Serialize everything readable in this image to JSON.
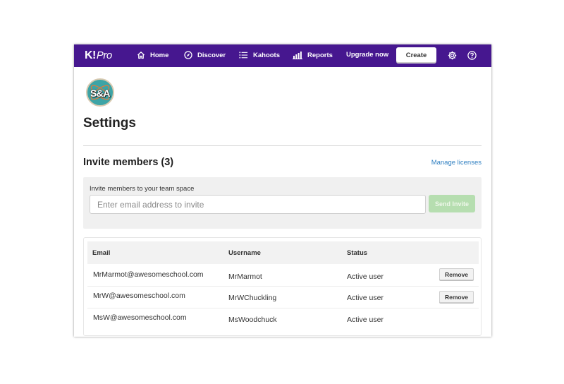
{
  "colors": {
    "nav_bg": "#46178f",
    "link": "#2f7fc1",
    "send_button_bg": "#b6deb0",
    "avatar_bg": "#3da4a6"
  },
  "nav": {
    "logo_main": "K!",
    "logo_pro": "Pro",
    "items": [
      {
        "label": "Home",
        "icon": "home-icon"
      },
      {
        "label": "Discover",
        "icon": "compass-icon"
      },
      {
        "label": "Kahoots",
        "icon": "list-icon"
      },
      {
        "label": "Reports",
        "icon": "bar-chart-icon"
      }
    ],
    "upgrade_label": "Upgrade now",
    "create_label": "Create",
    "settings_icon": "gear-icon",
    "help_icon": "help-icon"
  },
  "avatar": {
    "text": "S&A"
  },
  "page": {
    "title": "Settings"
  },
  "invite": {
    "section_title": "Invite members (3)",
    "manage_link": "Manage licenses",
    "label": "Invite members to your team space",
    "input_placeholder": "Enter email address to invite",
    "input_value": "",
    "send_label": "Send Invite"
  },
  "members": {
    "headers": {
      "email": "Email",
      "username": "Username",
      "status": "Status"
    },
    "remove_label": "Remove",
    "rows": [
      {
        "email": "MrMarmot@awesomeschool.com",
        "username": "MrMarmot",
        "status": "Active user",
        "removable": true
      },
      {
        "email": "MrW@awesomeschool.com",
        "username": "MrWChuckling",
        "status": "Active user",
        "removable": true
      },
      {
        "email": "MsW@awesomeschool.com",
        "username": "MsWoodchuck",
        "status": "Active user",
        "removable": false
      }
    ]
  }
}
